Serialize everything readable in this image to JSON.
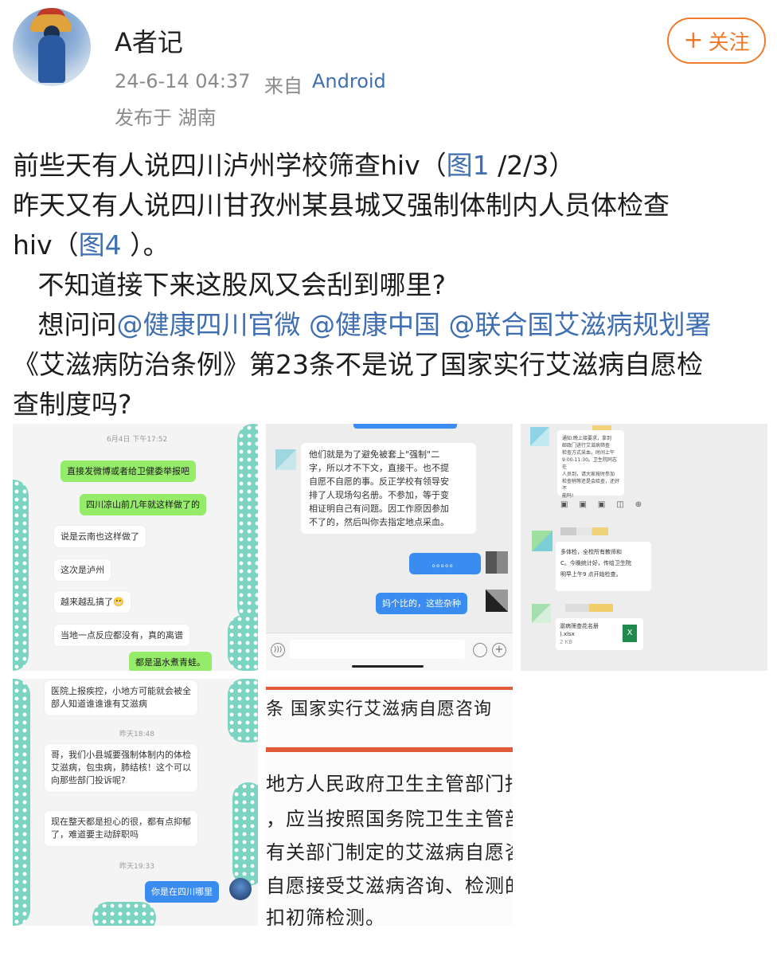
{
  "post": {
    "author": "A者记",
    "time": "24-6-14 04:37",
    "source_prefix": "来自",
    "device": "Android",
    "location": "发布于 湖南",
    "follow_label": "关注",
    "follow_icon": "plus-icon",
    "text": {
      "l1_a": "前些天有人说四川泸州学校筛查hiv（",
      "l1_link": "图1",
      "l1_b": " /2/3）",
      "l2": "昨天又有人说四川甘孜州某县城又强制体制内人员体检查",
      "l3_a": "hiv（",
      "l3_link": "图4",
      "l3_b": " ）。",
      "l4": "   不知道接下来这股风又会刮到哪里?",
      "l5_a": "   想问问",
      "mention1": "@健康四川官微",
      "mention2": "@健康中国",
      "mention3": "@联合国艾滋病规划署",
      "l6": "《艾滋病防治条例》第23条不是说了国家实行艾滋病自愿检",
      "l7": "查制度吗?"
    }
  },
  "images": {
    "img1": {
      "timestamp": "6月4日 下午17:52",
      "msgs": [
        "直接发微博或者给卫健委举报吧",
        "四川凉山前几年就这样做了的",
        "说是云南也这样做了",
        "这次是泸州",
        "越来越乱搞了😬",
        "当地一点反应都没有，真的离谱",
        "都是温水煮青蛙。"
      ]
    },
    "img2": {
      "msg": [
        "他们就是为了避免被套上\"强制\"二",
        "字，所以才不下文，直接干。也不提",
        "自愿不自愿的事。反正学校有领导安",
        "排了人现场勾名册。不参加，等于变",
        "相证明自己有问题。因工作原因参加",
        "不了的，然后叫你去指定地点采血。"
      ],
      "reply1": "。。。。。",
      "reply2": "妈个比的，这些杂种"
    },
    "img3": {
      "notice": [
        "通知:晚上接要求，拿到",
        "邮政门进行艾滋病筛查",
        "检查方式采血，时间上午",
        "9:00-11:30。卫生院同志在",
        "人员到，请大家按时参加",
        "检查稍等还是会给查，还好不",
        "能吗!"
      ],
      "msg2": [
        "多体检，全校所有教师和",
        "C。今晚统计好，传给卫生院",
        "明早上午9 点开始检查。"
      ],
      "file_name": "滋病筛查花名册",
      "file_ext": ").xlsx",
      "file_size": "2 KB",
      "file_icon": "excel-icon"
    },
    "img4": {
      "msg1": [
        "医院上报疾控，小地方可能就会被全",
        "部人知道谁谁谁有艾滋病"
      ],
      "ts1": "昨天18:48",
      "msg2": [
        "哥，我们小县城要强制体制内的体检",
        "艾滋病，包虫病，肺结核！这个可以",
        "向那些部门投诉呢?"
      ],
      "msg3": [
        "现在整天都是担心的很，都有点抑郁",
        "了，难道要主动辞职吗"
      ],
      "ts2": "昨天19:33",
      "reply": "你是在四川哪里"
    },
    "img5": {
      "heading": "条   国家实行艾滋病自愿咨询",
      "lines": [
        "地方人民政府卫生主管部门指",
        "，应当按照国务院卫生主管部",
        "有关部门制定的艾滋病自愿咨",
        "自愿接受艾滋病咨询、检测的",
        "扣初筛检测。"
      ]
    }
  }
}
